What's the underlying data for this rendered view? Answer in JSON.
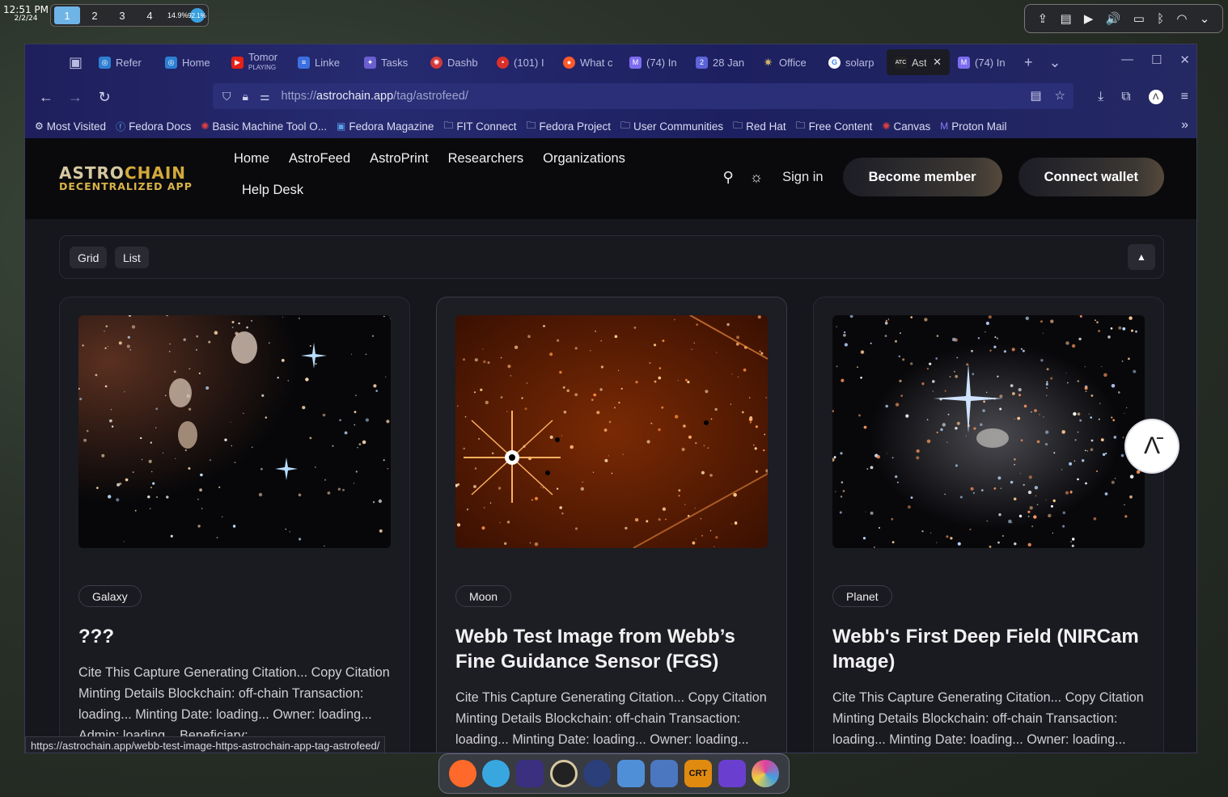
{
  "panel": {
    "time": "12:51 PM",
    "date": "2/2/24",
    "workspaces": [
      "1",
      "2",
      "3",
      "4"
    ],
    "active_workspace": "1",
    "meter_cpu": "14.9%",
    "meter_mem": "92.1%"
  },
  "browser": {
    "tabs": [
      {
        "label": "Refer",
        "icon_color": "#2d7fd3",
        "icon": "compass-icon"
      },
      {
        "label": "Home",
        "icon_color": "#2d7fd3",
        "icon": "compass-icon"
      },
      {
        "label": "Tomor",
        "sub": "PLAYING",
        "icon_color": "#e62117",
        "icon": "youtube-icon"
      },
      {
        "label": "Linke",
        "icon_color": "#3c6fe0",
        "icon": "doc-icon"
      },
      {
        "label": "Tasks",
        "icon_color": "#6b5fd0",
        "icon": "tasks-icon"
      },
      {
        "label": "Dashb",
        "icon_color": "#d23b3b",
        "icon": "gear-icon"
      },
      {
        "label": "(101) I",
        "icon_color": "#d9302a",
        "icon": "badge-icon"
      },
      {
        "label": "What c",
        "icon_color": "#ff5a2a",
        "icon": "reddit-icon"
      },
      {
        "label": "(74) In",
        "icon_color": "#7d6cf0",
        "icon": "mail-icon"
      },
      {
        "label": "28 Jan",
        "icon_color": "#5c63d8",
        "icon": "calendar-icon"
      },
      {
        "label": "Office",
        "icon_color": "#d2b46a",
        "icon": "spark-icon"
      },
      {
        "label": "solarp",
        "icon_color": "#ffffff",
        "icon": "google-icon"
      },
      {
        "label": "Astr",
        "icon_color": "#222222",
        "icon": "astro-icon",
        "active": true
      },
      {
        "label": "(74) In",
        "icon_color": "#7d6cf0",
        "icon": "mail-icon"
      }
    ],
    "url_prefix": "https://",
    "url_host": "astrochain.app",
    "url_path": "/tag/astrofeed/",
    "bookmarks": [
      {
        "label": "Most Visited",
        "icon": "gear-icon"
      },
      {
        "label": "Fedora Docs",
        "icon": "fedora-icon"
      },
      {
        "label": "Basic Machine Tool O...",
        "icon": "gear-icon"
      },
      {
        "label": "Fedora Magazine",
        "icon": "magazine-icon"
      },
      {
        "label": "FIT Connect",
        "icon": "folder-icon"
      },
      {
        "label": "Fedora Project",
        "icon": "folder-icon"
      },
      {
        "label": "User Communities",
        "icon": "folder-icon"
      },
      {
        "label": "Red Hat",
        "icon": "folder-icon"
      },
      {
        "label": "Free Content",
        "icon": "folder-icon"
      },
      {
        "label": "Canvas",
        "icon": "gear-icon"
      },
      {
        "label": "Proton Mail",
        "icon": "mail-icon"
      }
    ],
    "status_url": "https://astrochain.app/webb-test-image-https-astrochain-app-tag-astrofeed/"
  },
  "site": {
    "logo_a": "ASTRO",
    "logo_b": "CHAIN",
    "logo_sub": "DECENTRALIZED APP",
    "menu": [
      "Home",
      "AstroFeed",
      "AstroPrint",
      "Researchers",
      "Organizations",
      "Help Desk"
    ],
    "sign_in": "Sign in",
    "become_member": "Become member",
    "connect_wallet": "Connect wallet",
    "view_grid": "Grid",
    "view_list": "List",
    "collapse_icon": "▲",
    "float_icon": "Λ̄"
  },
  "cards": [
    {
      "tag": "Galaxy",
      "title": "???",
      "desc": "Cite This Capture Generating Citation... Copy Citation Minting Details Blockchain: off-chain Transaction: loading... Minting Date: loading... Owner: loading... Admin: loading... Beneficiary:"
    },
    {
      "tag": "Moon",
      "title": "Webb Test Image from Webb’s Fine Guidance Sensor (FGS)",
      "desc": "Cite This Capture Generating Citation... Copy Citation Minting Details Blockchain: off-chain Transaction: loading... Minting Date: loading... Owner: loading... Admin: loading... Beneficiary:"
    },
    {
      "tag": "Planet",
      "title": "Webb's First Deep Field (NIRCam Image)",
      "desc": "Cite This Capture Generating Citation... Copy Citation Minting Details Blockchain: off-chain Transaction: loading... Minting Date: loading... Owner: loading... Admin: loading... Beneficiary:"
    }
  ],
  "dock": [
    {
      "name": "firefox-icon",
      "color": "#ff6a2a"
    },
    {
      "name": "globe-icon",
      "color": "#38a7e0"
    },
    {
      "name": "night-icon",
      "color": "#3b2f80"
    },
    {
      "name": "eclipse-icon",
      "color": "#222222"
    },
    {
      "name": "snow-icon",
      "color": "#2b3f7a"
    },
    {
      "name": "folder-icon",
      "color": "#4f8fd8"
    },
    {
      "name": "editor-icon",
      "color": "#4a77c0"
    },
    {
      "name": "crt-icon",
      "color": "#e08a10"
    },
    {
      "name": "obsidian-icon",
      "color": "#6a3fd0"
    },
    {
      "name": "color-icon",
      "color": "#e040a0"
    }
  ]
}
